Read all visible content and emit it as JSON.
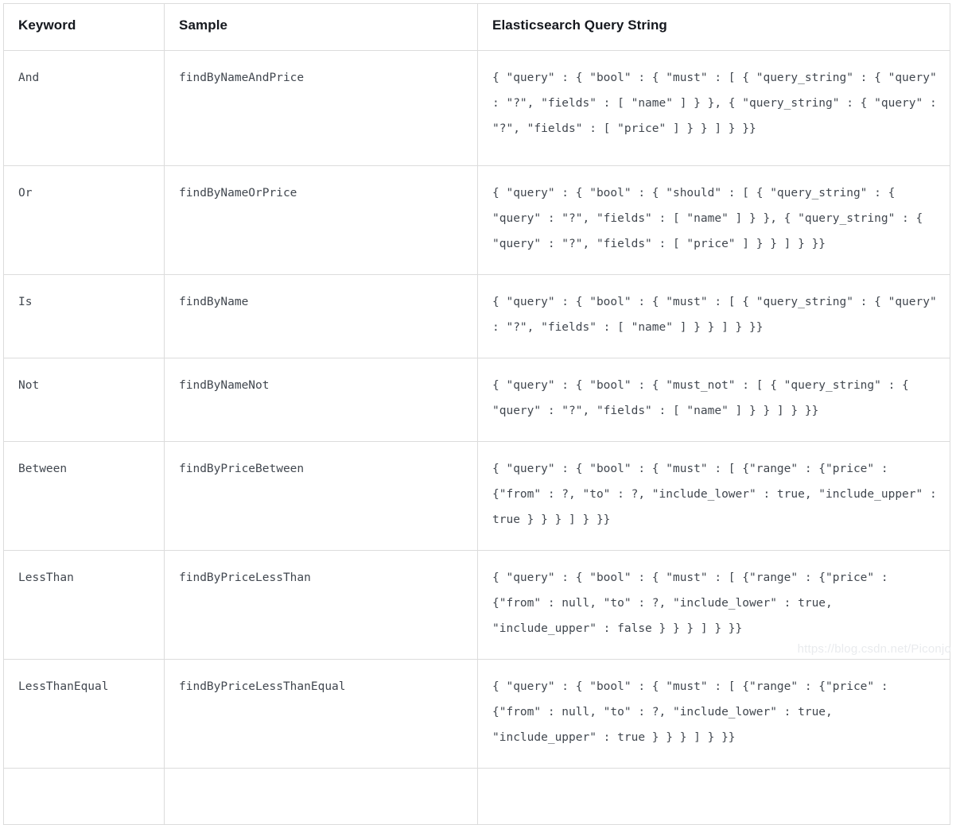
{
  "table": {
    "columns": [
      {
        "key": "keyword",
        "label": "Keyword"
      },
      {
        "key": "sample",
        "label": "Sample"
      },
      {
        "key": "query",
        "label": "Elasticsearch Query String"
      }
    ],
    "rows": [
      {
        "keyword": "And",
        "sample": "findByNameAndPrice",
        "query": "{ \"query\" : { \"bool\" : { \"must\" : [ { \"query_string\" : { \"query\" : \"?\", \"fields\" : [ \"name\" ] } }, { \"query_string\" : { \"query\" : \"?\", \"fields\" : [ \"price\" ] } } ] } }}"
      },
      {
        "keyword": "Or",
        "sample": "findByNameOrPrice",
        "query": "{ \"query\" : { \"bool\" : { \"should\" : [ { \"query_string\" : { \"query\" : \"?\", \"fields\" : [ \"name\" ] } }, { \"query_string\" : { \"query\" : \"?\", \"fields\" : [ \"price\" ] } } ] } }}"
      },
      {
        "keyword": "Is",
        "sample": "findByName",
        "query": "{ \"query\" : { \"bool\" : { \"must\" : [ { \"query_string\" : { \"query\" : \"?\", \"fields\" : [ \"name\" ] } } ] } }}"
      },
      {
        "keyword": "Not",
        "sample": "findByNameNot",
        "query": "{ \"query\" : { \"bool\" : { \"must_not\" : [ { \"query_string\" : { \"query\" : \"?\", \"fields\" : [ \"name\" ] } } ] } }}"
      },
      {
        "keyword": "Between",
        "sample": "findByPriceBetween",
        "query": "{ \"query\" : { \"bool\" : { \"must\" : [ {\"range\" : {\"price\" : {\"from\" : ?, \"to\" : ?, \"include_lower\" : true, \"include_upper\" : true } } } ] } }}"
      },
      {
        "keyword": "LessThan",
        "sample": "findByPriceLessThan",
        "query": "{ \"query\" : { \"bool\" : { \"must\" : [ {\"range\" : {\"price\" : {\"from\" : null, \"to\" : ?, \"include_lower\" : true, \"include_upper\" : false } } } ] } }}"
      },
      {
        "keyword": "LessThanEqual",
        "sample": "findByPriceLessThanEqual",
        "query": "{ \"query\" : { \"bool\" : { \"must\" : [ {\"range\" : {\"price\" : {\"from\" : null, \"to\" : ?, \"include_lower\" : true, \"include_upper\" : true } } } ] } }}"
      },
      {
        "keyword": "",
        "sample": "",
        "query": ""
      }
    ]
  },
  "watermark": {
    "text": "https://blog.csdn.net/Piconjo"
  },
  "colors": {
    "border": "#dcdcdc",
    "header_text": "#15181e",
    "body_text": "#41474f",
    "background": "#ffffff",
    "watermark_text": "#e9ebee"
  }
}
